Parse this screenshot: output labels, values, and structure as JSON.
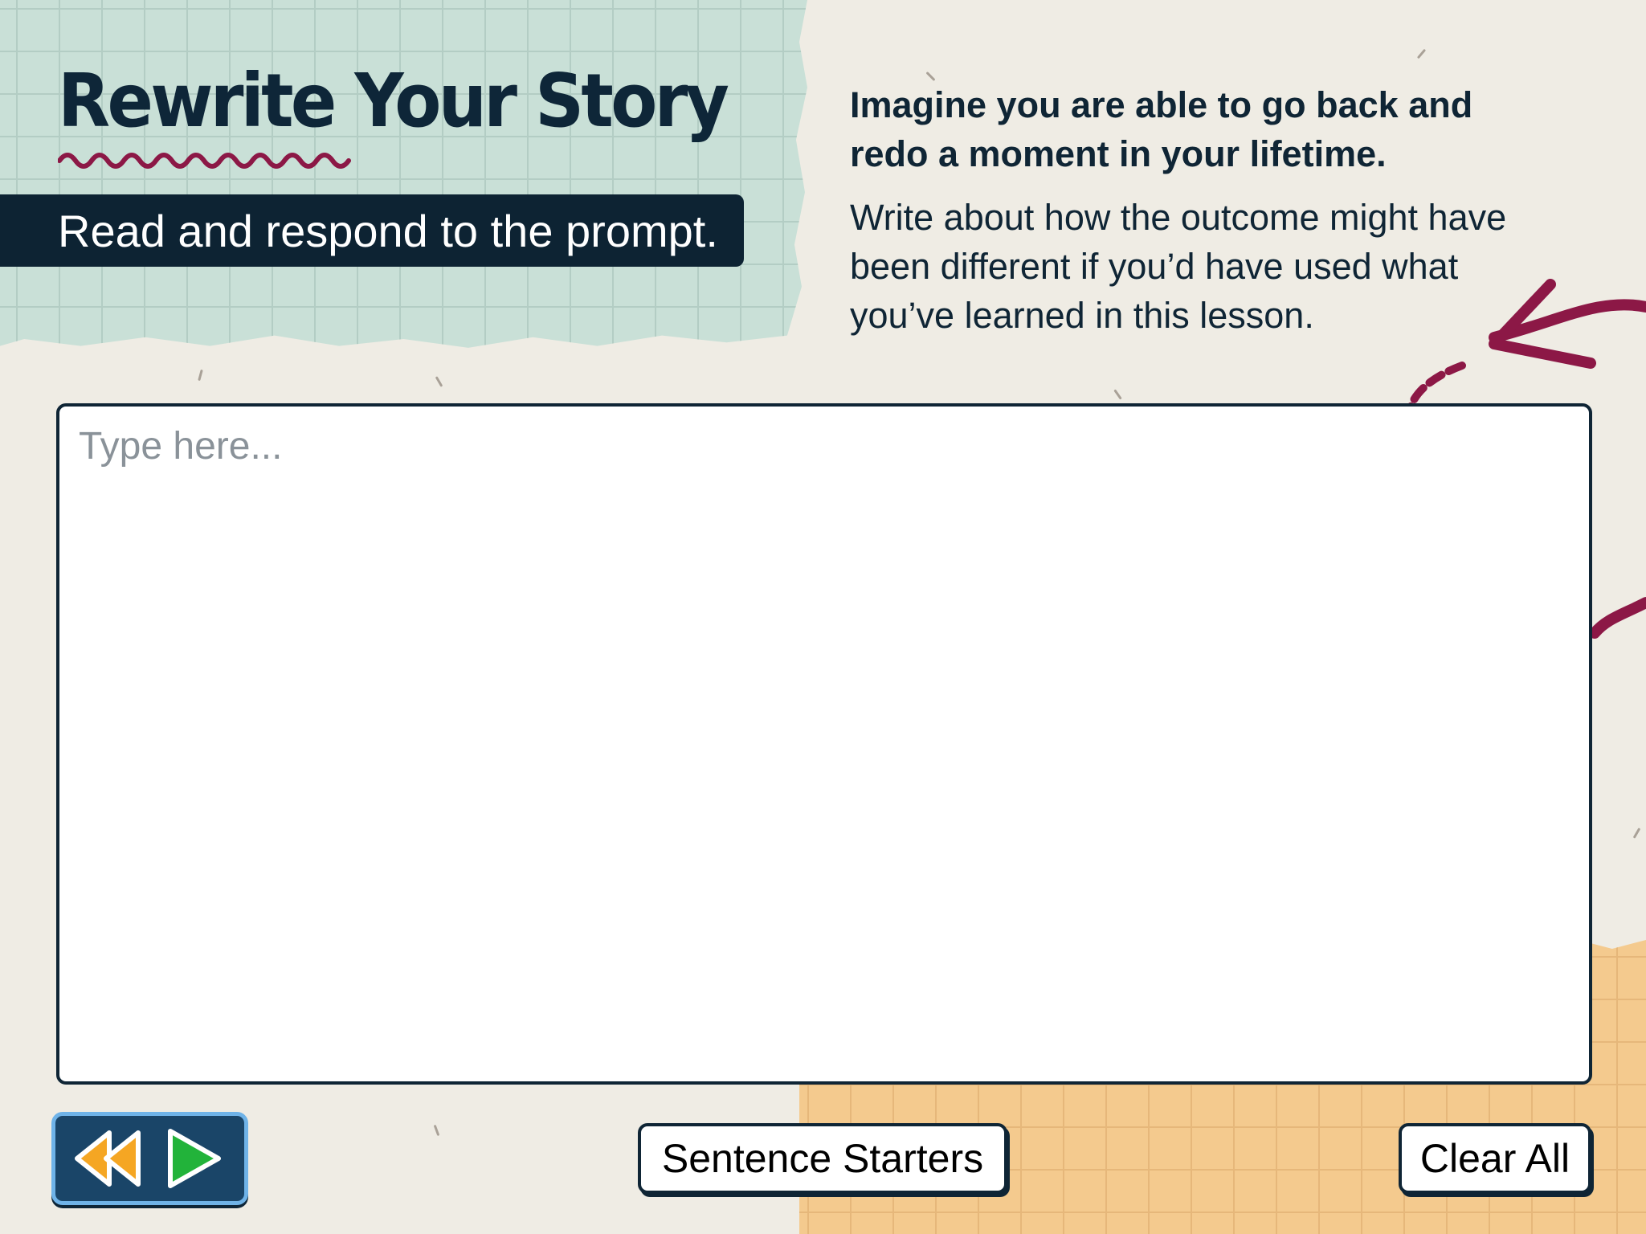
{
  "header": {
    "title": "Rewrite Your Story",
    "subtitle": "Read and respond to the prompt."
  },
  "prompt": {
    "bold_text": "Imagine you are able to go back and redo a moment in your lifetime.",
    "body_text": "Write about how the outcome might have been different if you’d have used what you’ve learned in this lesson."
  },
  "response": {
    "placeholder": "Type here...",
    "value": ""
  },
  "navigation": {
    "back_icon": "rewind-icon",
    "next_icon": "play-icon"
  },
  "buttons": {
    "sentence_starters": "Sentence Starters",
    "clear_all": "Clear All"
  },
  "colors": {
    "navy": "#0f2535",
    "accent_maroon": "#8c1846",
    "green_paper": "#c9e0d7",
    "orange_paper": "#f4ca8e",
    "nav_blue": "#1a4568",
    "back_orange": "#f5a623",
    "next_green": "#22b33a"
  }
}
